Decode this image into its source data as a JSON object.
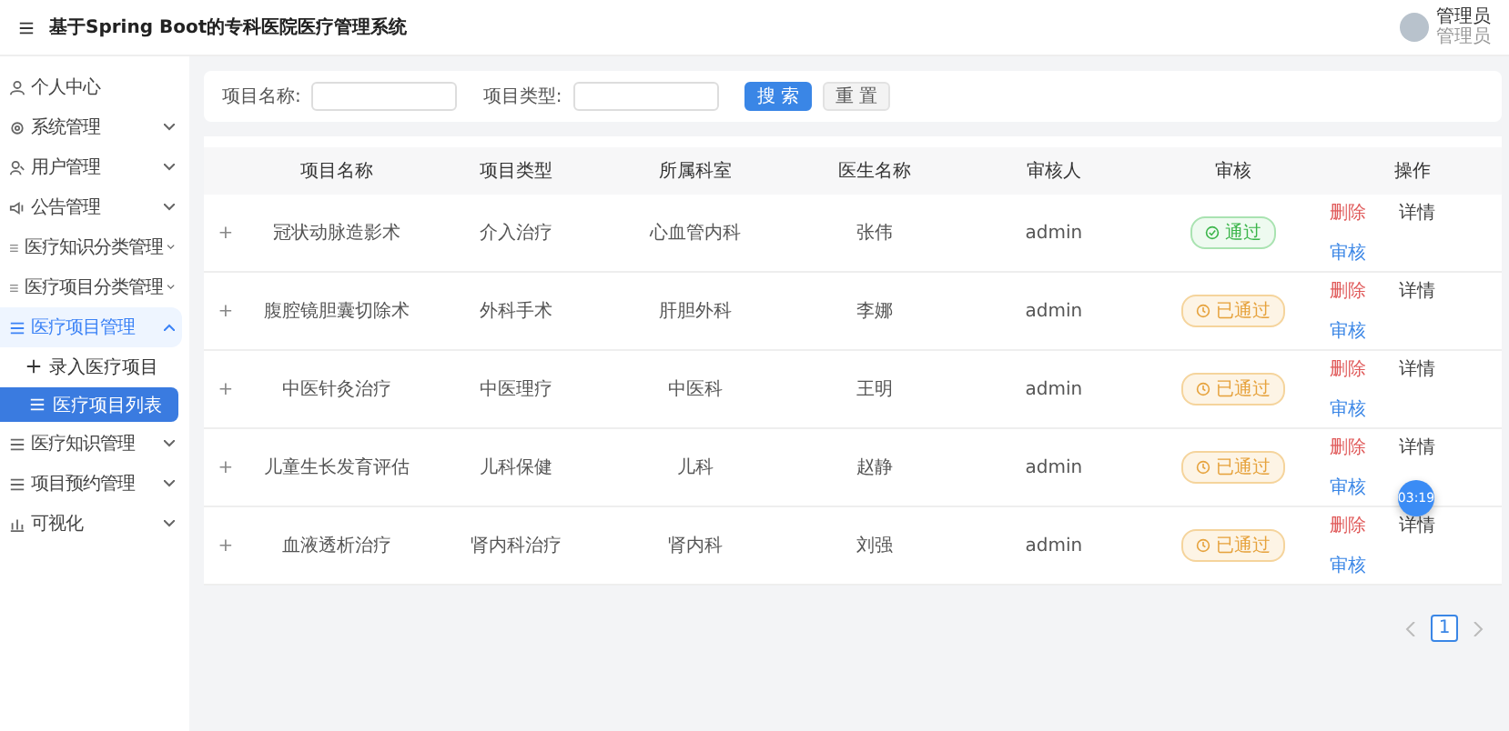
{
  "header": {
    "title": "基于Spring Boot的专科医院医疗管理系统",
    "user": {
      "name": "管理员",
      "role": "管理员"
    }
  },
  "sidebar": {
    "items": [
      {
        "label": "个人中心",
        "selected": false
      },
      {
        "label": "系统管理",
        "expanded": false,
        "selected": false
      },
      {
        "label": "用户管理",
        "expanded": false,
        "selected": false
      },
      {
        "label": "公告管理",
        "expanded": false,
        "selected": false
      },
      {
        "label": "医疗知识分类管理",
        "expanded": false,
        "selected": false
      },
      {
        "label": "医疗项目分类管理",
        "expanded": false,
        "selected": false
      },
      {
        "label": "医疗项目管理",
        "expanded": true,
        "selected": true,
        "children": [
          {
            "label": "录入医疗项目",
            "selected": false
          },
          {
            "label": "医疗项目列表",
            "selected": true
          }
        ]
      },
      {
        "label": "医疗知识管理",
        "expanded": false,
        "selected": false
      },
      {
        "label": "项目预约管理",
        "expanded": false,
        "selected": false
      },
      {
        "label": "可视化",
        "expanded": false,
        "selected": false
      }
    ]
  },
  "search": {
    "fields": [
      {
        "label": "项目名称:"
      },
      {
        "label": "项目类型:"
      }
    ],
    "buttons": [
      {
        "label": "搜 索",
        "kind": "primary"
      },
      {
        "label": "重 置",
        "kind": "plain"
      }
    ]
  },
  "table": {
    "expand_symbol": "+",
    "columns": [
      "项目名称",
      "项目类型",
      "所属科室",
      "医生名称",
      "审核人",
      "审核",
      "操作"
    ],
    "rows": [
      {
        "name": "冠状动脉造影术",
        "type": "介入治疗",
        "department": "心血管内科",
        "doctor": "张伟",
        "reviewer": "admin",
        "status": {
          "label": "通过",
          "kind": "passed"
        },
        "actions": [
          "删除",
          "详情",
          "审核"
        ]
      },
      {
        "name": "腹腔镜胆囊切除术",
        "type": "外科手术",
        "department": "肝胆外科",
        "doctor": "李娜",
        "reviewer": "admin",
        "status": {
          "label": "已通过",
          "kind": "pending"
        },
        "actions": [
          "删除",
          "详情",
          "审核"
        ]
      },
      {
        "name": "中医针灸治疗",
        "type": "中医理疗",
        "department": "中医科",
        "doctor": "王明",
        "reviewer": "admin",
        "status": {
          "label": "已通过",
          "kind": "pending"
        },
        "actions": [
          "删除",
          "详情",
          "审核"
        ]
      },
      {
        "name": "儿童生长发育评估",
        "type": "儿科保健",
        "department": "儿科",
        "doctor": "赵静",
        "reviewer": "admin",
        "status": {
          "label": "已通过",
          "kind": "pending"
        },
        "actions": [
          "删除",
          "详情",
          "审核"
        ]
      },
      {
        "name": "血液透析治疗",
        "type": "肾内科治疗",
        "department": "肾内科",
        "doctor": "刘强",
        "reviewer": "admin",
        "status": {
          "label": "已通过",
          "kind": "pending"
        },
        "actions": [
          "删除",
          "详情",
          "审核"
        ]
      }
    ]
  },
  "pagination": {
    "pages": [
      {
        "label": "1",
        "selected": true
      }
    ]
  },
  "timer_badge": "03:19"
}
